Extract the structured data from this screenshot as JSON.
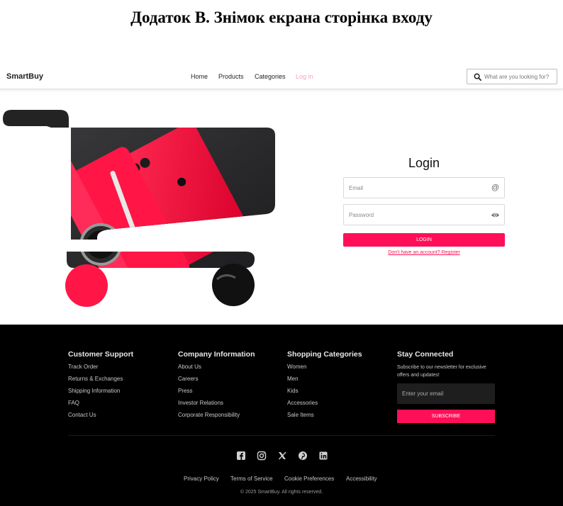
{
  "document_heading": "Додаток В. Знімок екрана сторінка входу",
  "navbar": {
    "logo": "SmartBuy",
    "links": [
      {
        "label": "Home"
      },
      {
        "label": "Products"
      },
      {
        "label": "Categories"
      },
      {
        "label": "Log in",
        "active": true
      }
    ],
    "search": {
      "placeholder": "What are you looking for?",
      "icon": "search-icon"
    }
  },
  "login": {
    "title": "Login",
    "email": {
      "placeholder": "Email",
      "icon": "at-icon"
    },
    "password": {
      "placeholder": "Password",
      "icon": "eye-icon"
    },
    "button": "LOGIN",
    "register_link": "Don't have an account? Register"
  },
  "footer": {
    "columns": [
      {
        "heading": "Customer Support",
        "links": [
          "Track Order",
          "Returns & Exchanges",
          "Shipping Information",
          "FAQ",
          "Contact Us"
        ]
      },
      {
        "heading": "Company Information",
        "links": [
          "About Us",
          "Careers",
          "Press",
          "Investor Relations",
          "Corporate Responsibility"
        ]
      },
      {
        "heading": "Shopping Categories",
        "links": [
          "Women",
          "Men",
          "Kids",
          "Accessories",
          "Sale Items"
        ]
      }
    ],
    "newsletter": {
      "heading": "Stay Connected",
      "text": "Subscribe to our newsletter for exclusive offers and updates!",
      "placeholder": "Enter your email",
      "button": "SUBSCRIBE"
    },
    "social": [
      "facebook-icon",
      "instagram-icon",
      "x-icon",
      "pinterest-icon",
      "linkedin-icon"
    ],
    "legal": [
      "Privacy Policy",
      "Terms of Service",
      "Cookie Preferences",
      "Accessibility"
    ],
    "copyright": "© 2025 SmartBuy. All rights reserved."
  },
  "colors": {
    "accent": "#ff0f57",
    "active_link": "#f4a6ba",
    "footer_bg": "#000000"
  }
}
